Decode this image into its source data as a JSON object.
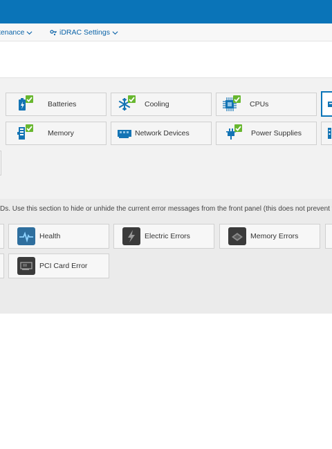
{
  "nav": {
    "maintenance_label": "tenance",
    "idrac_settings_label": "iDRAC Settings"
  },
  "components": [
    {
      "label": "Batteries",
      "icon": "battery-icon",
      "status": "ok"
    },
    {
      "label": "Cooling",
      "icon": "snowflake-icon",
      "status": "ok"
    },
    {
      "label": "CPUs",
      "icon": "cpu-icon",
      "status": "ok"
    },
    {
      "label": "Memory",
      "icon": "memory-icon",
      "status": "ok"
    },
    {
      "label": "Network Devices",
      "icon": "network-card-icon",
      "status": "none"
    },
    {
      "label": "Power Supplies",
      "icon": "power-plug-icon",
      "status": "ok"
    }
  ],
  "lcd_section": {
    "description": "Ds. Use this section to hide or unhide the current error messages from the front panel (this does not prevent future",
    "items": [
      {
        "label": "Health",
        "icon": "heartbeat-icon"
      },
      {
        "label": "Electric Errors",
        "icon": "lightning-icon"
      },
      {
        "label": "Memory Errors",
        "icon": "memory-chip-icon"
      },
      {
        "label": "PCI Card Error",
        "icon": "pci-card-icon"
      }
    ]
  },
  "colors": {
    "brand_blue": "#0a74b8",
    "ok_green": "#68b72f",
    "icon_blue": "#1474b4"
  }
}
